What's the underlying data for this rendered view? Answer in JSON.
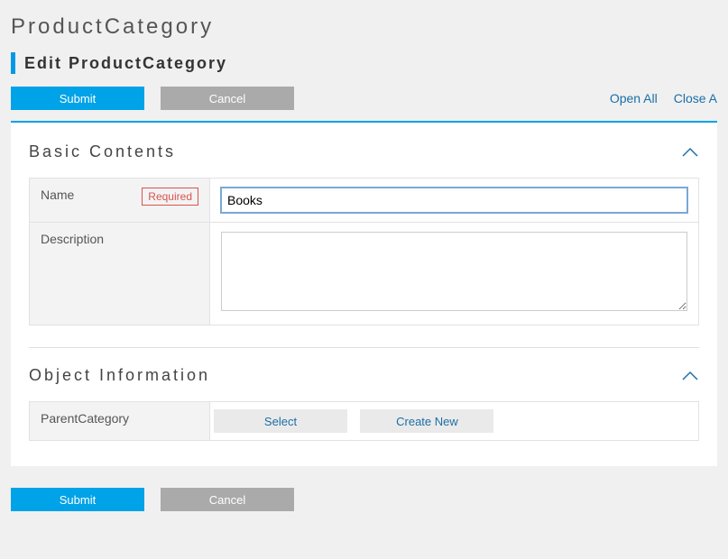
{
  "page": {
    "title": "ProductCategory",
    "subtitle": "Edit ProductCategory"
  },
  "actions": {
    "submit_label": "Submit",
    "cancel_label": "Cancel",
    "open_all_label": "Open All",
    "close_all_label": "Close A"
  },
  "sections": {
    "basic": {
      "title": "Basic Contents",
      "fields": {
        "name": {
          "label": "Name",
          "required_badge": "Required",
          "value": "Books"
        },
        "description": {
          "label": "Description",
          "value": ""
        }
      }
    },
    "object_info": {
      "title": "Object Information",
      "fields": {
        "parent_category": {
          "label": "ParentCategory",
          "select_label": "Select",
          "create_new_label": "Create New"
        }
      }
    }
  }
}
